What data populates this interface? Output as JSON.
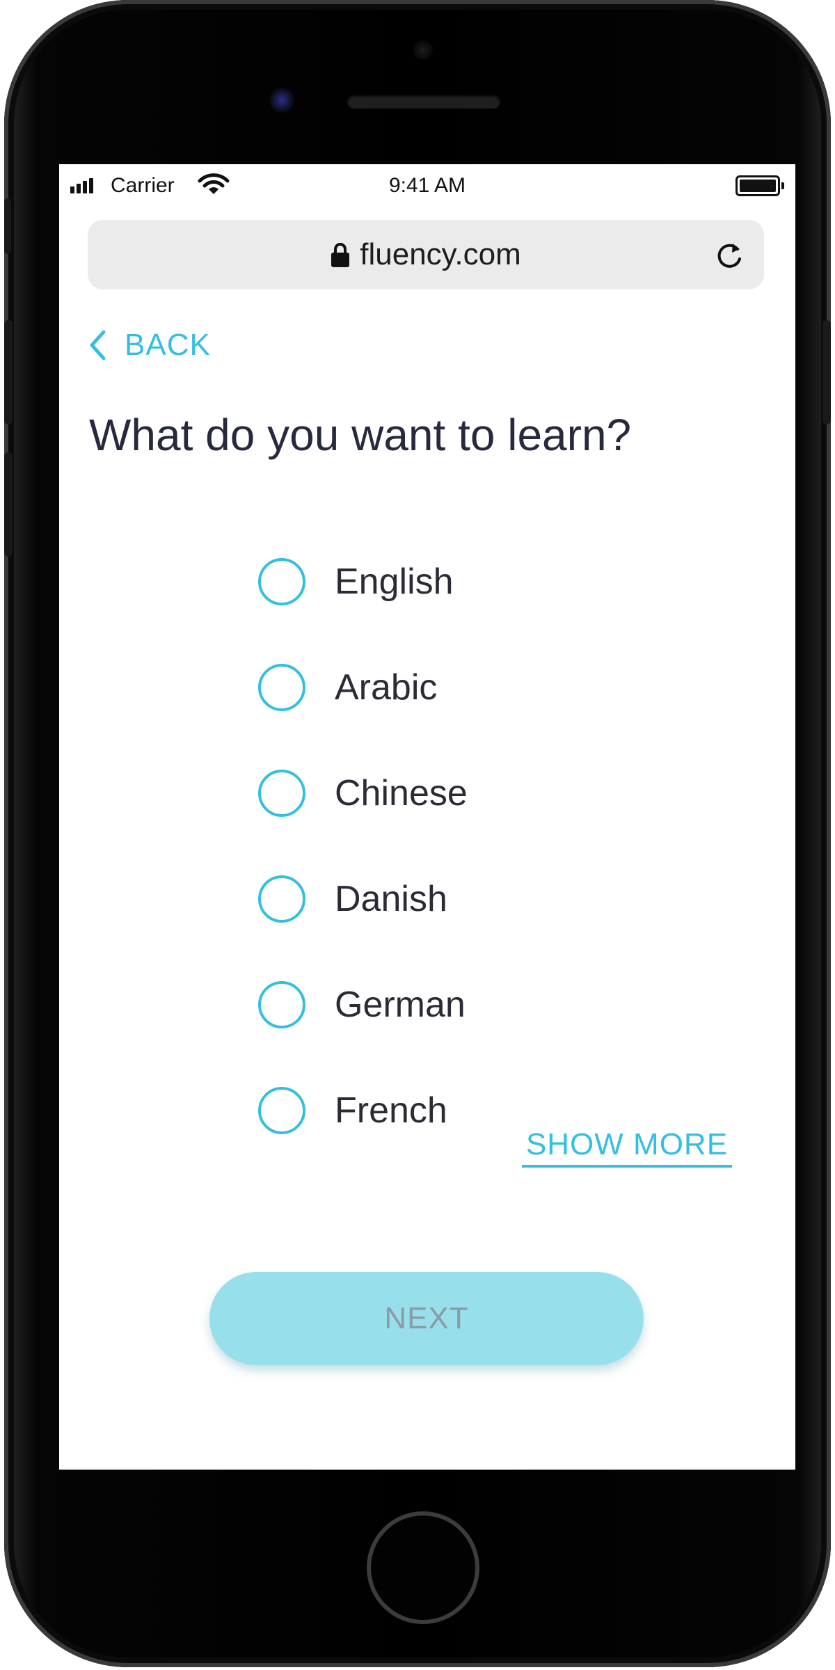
{
  "status_bar": {
    "carrier": "Carrier",
    "time": "9:41 AM"
  },
  "browser": {
    "url": "fluency.com"
  },
  "nav": {
    "back_label": "BACK"
  },
  "question": {
    "title": "What do you want to learn?"
  },
  "options": [
    {
      "label": "English",
      "selected": false
    },
    {
      "label": "Arabic",
      "selected": false
    },
    {
      "label": "Chinese",
      "selected": false
    },
    {
      "label": "Danish",
      "selected": false
    },
    {
      "label": "German",
      "selected": false
    },
    {
      "label": "French",
      "selected": false
    }
  ],
  "show_more_label": "SHOW MORE",
  "next_label": "NEXT",
  "colors": {
    "accent": "#35bfde",
    "next_button": "#97dfeb",
    "title_text": "#27293f"
  }
}
